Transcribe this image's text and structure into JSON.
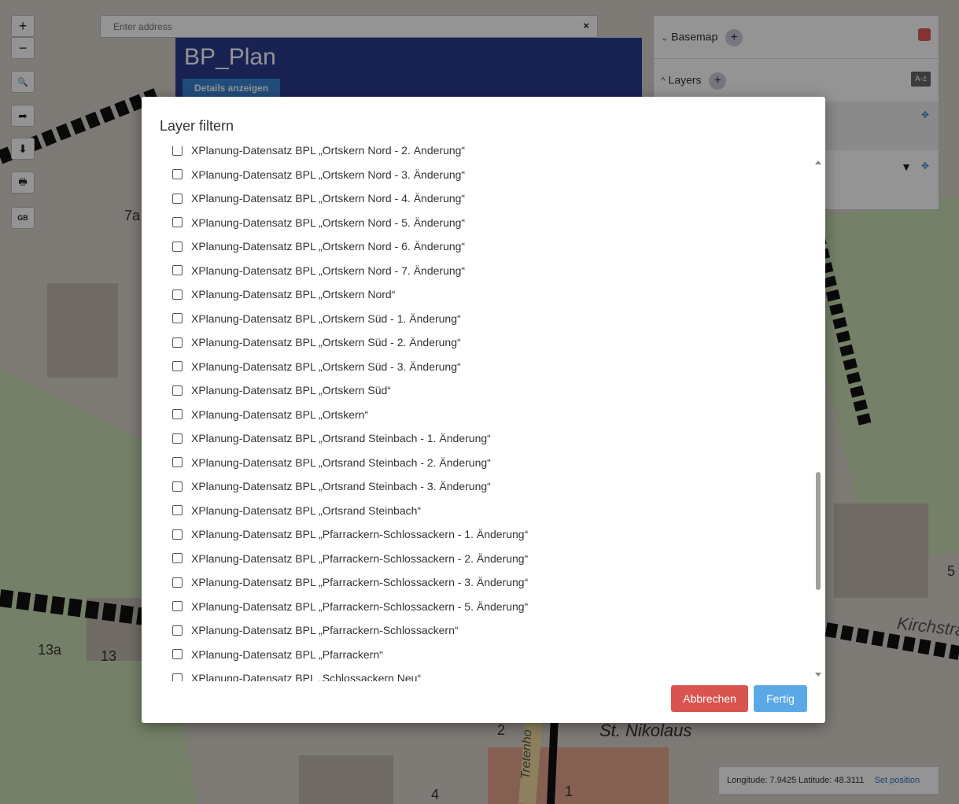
{
  "search": {
    "placeholder": "Enter address",
    "close_glyph": "×"
  },
  "map_controls": [
    {
      "name": "zoom-in-button",
      "glyph": "+"
    },
    {
      "name": "zoom-out-button",
      "glyph": "−"
    },
    {
      "name": "search-tool-button",
      "glyph": "🔍"
    },
    {
      "name": "share-button",
      "glyph": "➦"
    },
    {
      "name": "download-button",
      "glyph": "⬇"
    },
    {
      "name": "print-button",
      "glyph": "🖶"
    },
    {
      "name": "gb-button",
      "glyph": "GB"
    }
  ],
  "info_panel": {
    "title": "BP_Plan",
    "details_button": "Details anzeigen"
  },
  "right_panel": {
    "basemap_label": "Basemap",
    "layers_label": "Layers",
    "sort_button": "A-z",
    "plus_glyph": "+"
  },
  "map_labels": {
    "street_kirch": "Kirchstra",
    "church": "St. Nikolaus",
    "street_treten": "Tretenho",
    "house_13a": "13a",
    "house_13": "13",
    "house_7a": "7a",
    "house_4": "4",
    "house_2": "2",
    "house_1": "1",
    "house_5": "5"
  },
  "coordinates": {
    "text": "Longitude: 7.9425 Latitude: 48.3111",
    "set_position": "Set position"
  },
  "modal": {
    "title": "Layer filtern",
    "items": [
      "XPlanung-Datensatz BPL „Ortskern Nord - 2. Änderung“",
      "XPlanung-Datensatz BPL „Ortskern Nord - 3. Änderung“",
      "XPlanung-Datensatz BPL „Ortskern Nord - 4. Änderung“",
      "XPlanung-Datensatz BPL „Ortskern Nord - 5. Änderung“",
      "XPlanung-Datensatz BPL „Ortskern Nord - 6. Änderung“",
      "XPlanung-Datensatz BPL „Ortskern Nord - 7. Änderung“",
      "XPlanung-Datensatz BPL „Ortskern Nord“",
      "XPlanung-Datensatz BPL „Ortskern Süd - 1. Änderung“",
      "XPlanung-Datensatz BPL „Ortskern Süd - 2. Änderung“",
      "XPlanung-Datensatz BPL „Ortskern Süd - 3. Änderung“",
      "XPlanung-Datensatz BPL „Ortskern Süd“",
      "XPlanung-Datensatz BPL „Ortskern“",
      "XPlanung-Datensatz BPL „Ortsrand Steinbach - 1. Änderung“",
      "XPlanung-Datensatz BPL „Ortsrand Steinbach - 2. Änderung“",
      "XPlanung-Datensatz BPL „Ortsrand Steinbach - 3. Änderung“",
      "XPlanung-Datensatz BPL „Ortsrand Steinbach“",
      "XPlanung-Datensatz BPL „Pfarrackern-Schlossackern - 1. Änderung“",
      "XPlanung-Datensatz BPL „Pfarrackern-Schlossackern - 2. Änderung“",
      "XPlanung-Datensatz BPL „Pfarrackern-Schlossackern - 3. Änderung“",
      "XPlanung-Datensatz BPL „Pfarrackern-Schlossackern - 5. Änderung“",
      "XPlanung-Datensatz BPL „Pfarrackern-Schlossackern“",
      "XPlanung-Datensatz BPL „Pfarrackern“",
      "XPlanung-Datensatz BPL „Schlossackern Neu“"
    ],
    "cancel_button": "Abbrechen",
    "done_button": "Fertig"
  }
}
